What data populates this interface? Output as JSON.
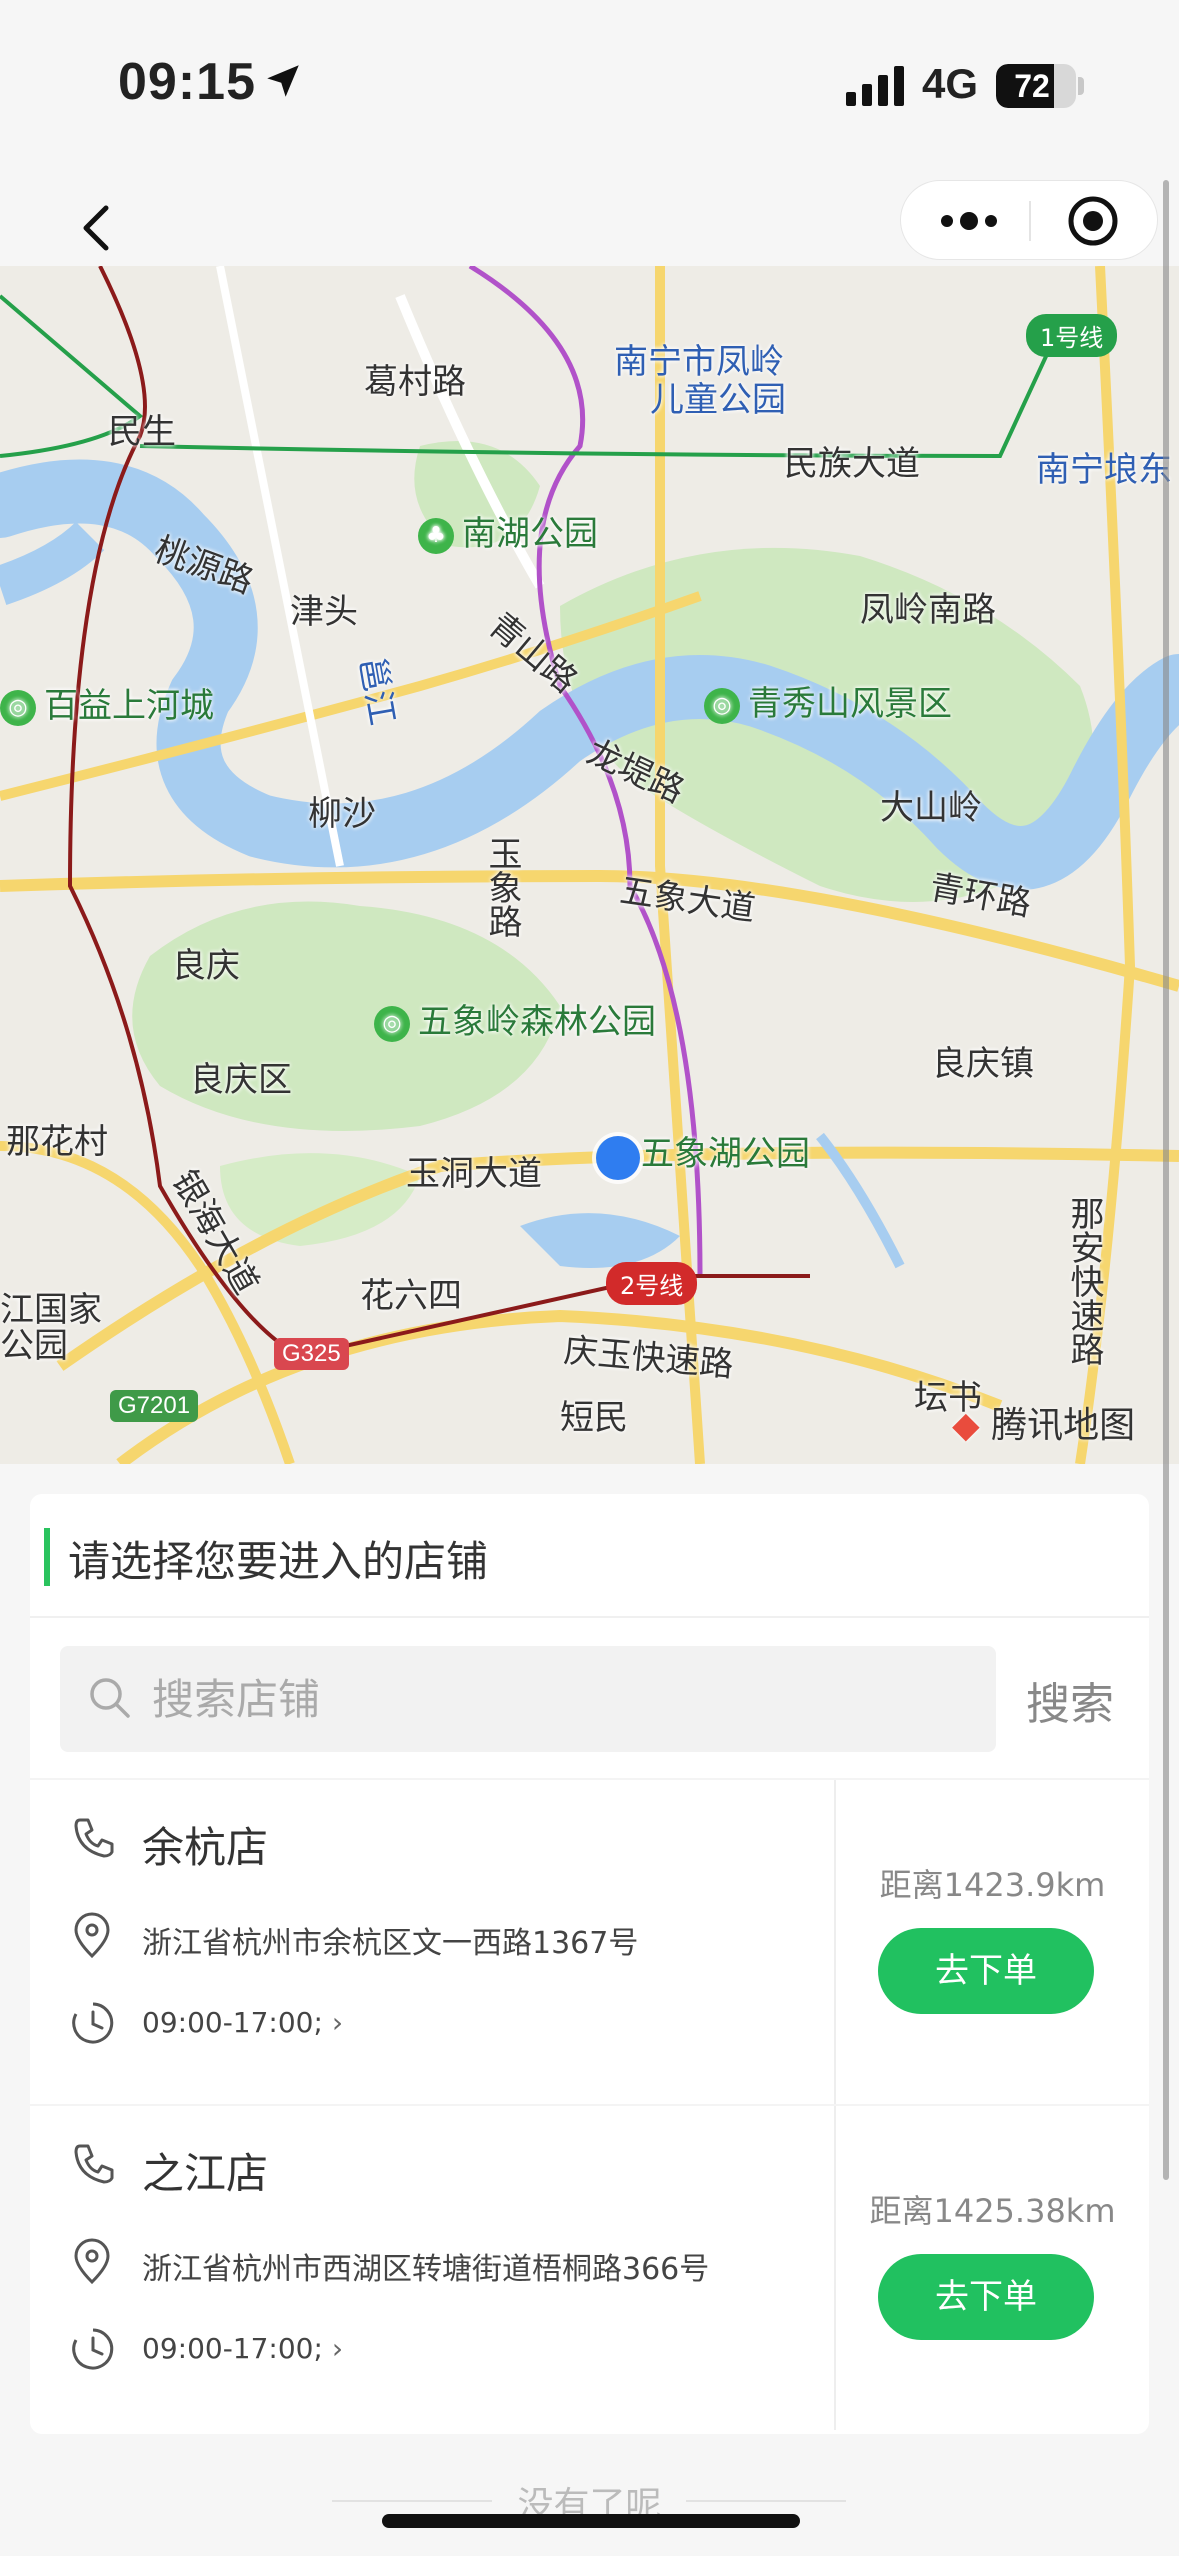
{
  "status": {
    "time": "09:15",
    "network": "4G",
    "battery": "72",
    "battery_level": 0.72
  },
  "nav": {
    "more_icon": "more-dots-icon",
    "close_icon": "target-close-icon"
  },
  "map": {
    "labels": [
      "葛村路",
      "南宁市凤岭",
      "儿童公园",
      "民生",
      "民族大道",
      "南宁埌东",
      "南湖公园",
      "桃源路",
      "津头",
      "青山路",
      "凤岭南路",
      "百益上河城",
      "邕江",
      "青秀山风景区",
      "龙堤路",
      "柳沙",
      "大山岭",
      "玉象路",
      "五象大道",
      "青环路",
      "良庆",
      "五象岭森林公园",
      "良庆镇",
      "良庆区",
      "那花村",
      "五象湖公园",
      "玉洞大道",
      "银海大道",
      "花六四",
      "那安快速路",
      "江国家",
      "公园",
      "庆玉快速路",
      "坛书",
      "短民"
    ],
    "badges": {
      "line1": "1号线",
      "line2": "2号线",
      "g325": "G325",
      "g7201": "G7201"
    },
    "attribution": "腾讯地图"
  },
  "panel": {
    "title": "请选择您要进入的店铺",
    "search_placeholder": "搜索店铺",
    "search_button": "搜索"
  },
  "stores": [
    {
      "name": "余杭店",
      "address": "浙江省杭州市余杭区文一西路1367号",
      "hours": "09:00-17:00;",
      "distance": "距离1423.9km",
      "action": "去下单"
    },
    {
      "name": "之江店",
      "address": "浙江省杭州市西湖区转塘街道梧桐路366号",
      "hours": "09:00-17:00;",
      "distance": "距离1425.38km",
      "action": "去下单"
    }
  ],
  "footer": {
    "end_text": "没有了呢"
  },
  "colors": {
    "accent": "#21c160",
    "metro_line2": "#d22a2a",
    "metro_line1": "#25a04a"
  }
}
